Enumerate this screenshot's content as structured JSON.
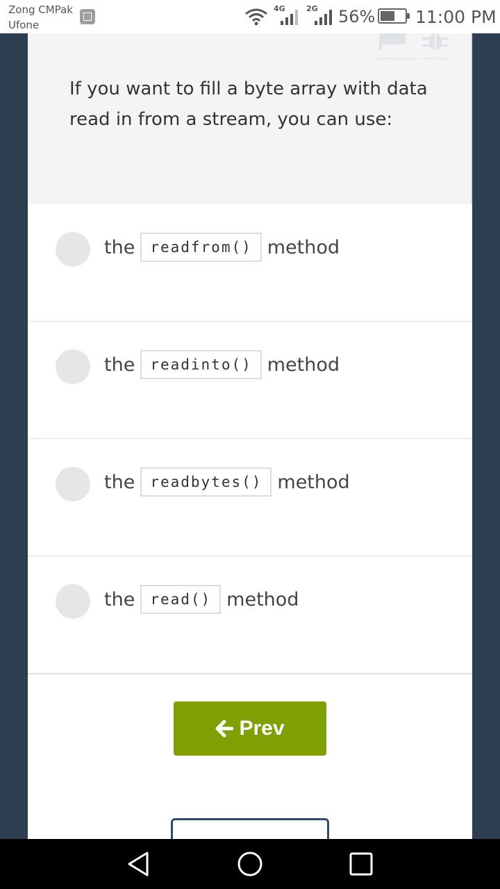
{
  "status_bar": {
    "carrier_primary": "Zong CMPak",
    "carrier_secondary": "Ufone",
    "network1": "4G",
    "network2": "2G",
    "battery_percent": "56%",
    "time": "11:00 PM"
  },
  "question": {
    "text": "If you want to fill a byte array with data read in from a stream, you can use:"
  },
  "options": [
    {
      "prefix": "the",
      "code": "readfrom()",
      "suffix": "method"
    },
    {
      "prefix": "the",
      "code": "readinto()",
      "suffix": "method"
    },
    {
      "prefix": "the",
      "code": "readbytes()",
      "suffix": "method"
    },
    {
      "prefix": "the",
      "code": "read()",
      "suffix": "method"
    }
  ],
  "navigation": {
    "prev_label": "Prev"
  },
  "icons": {
    "header_actions": [
      "flag-icon",
      "bug-icon"
    ],
    "prev_button": "arrow-left-icon",
    "system_nav": [
      "back-icon",
      "home-icon",
      "recent-apps-icon"
    ]
  },
  "colors": {
    "accent_green": "#7fa000",
    "page_background": "#2d3e50",
    "question_background": "#f4f4f4"
  }
}
